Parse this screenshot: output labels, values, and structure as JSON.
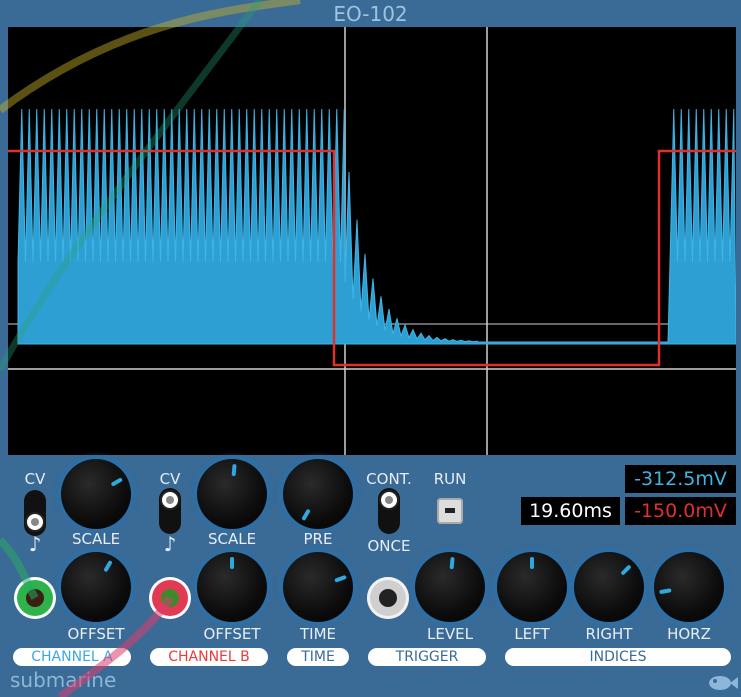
{
  "title": "EO-102",
  "brand": "submarine",
  "colors": {
    "panel": "#3a6a96",
    "trace_a": "#2e9fd3",
    "trace_b": "#e0302e",
    "screen": "#000000"
  },
  "channel_a": {
    "cv_label": "CV",
    "note_glyph": "♪",
    "scale_label": "SCALE",
    "offset_label": "OFFSET",
    "tag": "CHANNEL A",
    "tag_color": "#3ba8e6"
  },
  "channel_b": {
    "cv_label": "CV",
    "note_glyph": "♪",
    "scale_label": "SCALE",
    "offset_label": "OFFSET",
    "tag": "CHANNEL B",
    "tag_color": "#e63c3c"
  },
  "time": {
    "pre_label": "PRE",
    "time_label": "TIME",
    "tag": "TIME"
  },
  "trigger": {
    "cont_label": "CONT.",
    "once_label": "ONCE",
    "run_label": "RUN",
    "level_label": "LEVEL",
    "tag": "TRIGGER"
  },
  "indices": {
    "left_label": "LEFT",
    "right_label": "RIGHT",
    "horz_label": "HORZ",
    "tag": "INDICES"
  },
  "readouts": {
    "voltage_a": "-312.5mV",
    "time": "19.60ms",
    "voltage_b": "-150.0mV"
  },
  "icons": {
    "logo": "submarine-fish-icon"
  }
}
